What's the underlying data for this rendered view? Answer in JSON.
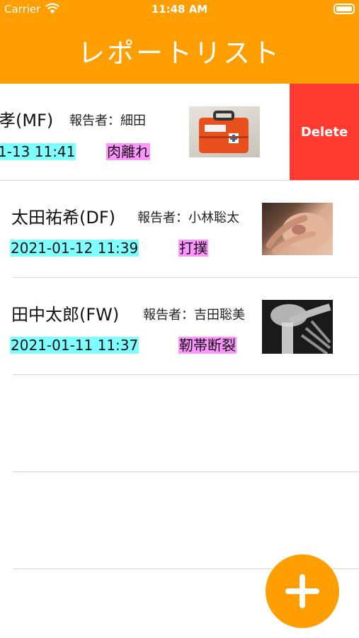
{
  "status_bar": {
    "carrier": "Carrier",
    "time": "11:48 AM"
  },
  "nav": {
    "title": "レポートリスト"
  },
  "reports": [
    {
      "name": "孝(MF)",
      "reporter": "報告者：細田",
      "date": "1-13 11:41",
      "injury": "肉離れ",
      "image": "first-aid-kit-photo"
    },
    {
      "name": "太田祐希(DF)",
      "reporter": "報告者：小林聡太",
      "date": "2021-01-12 11:39",
      "injury": "打撲",
      "image": "bruised-hand-photo"
    },
    {
      "name": "田中太郎(FW)",
      "reporter": "報告者：吉田聡美",
      "date": "2021-01-11 11:37",
      "injury": "靭帯断裂",
      "image": "shoulder-xray-photo"
    }
  ],
  "swipe_action": {
    "label": "Delete"
  },
  "fab": {
    "icon": "plus-icon"
  },
  "colors": {
    "accent": "#FF9E00",
    "delete": "#FF3B30",
    "date_highlight": "#7FFFFF",
    "injury_highlight": "#FF95FF"
  }
}
